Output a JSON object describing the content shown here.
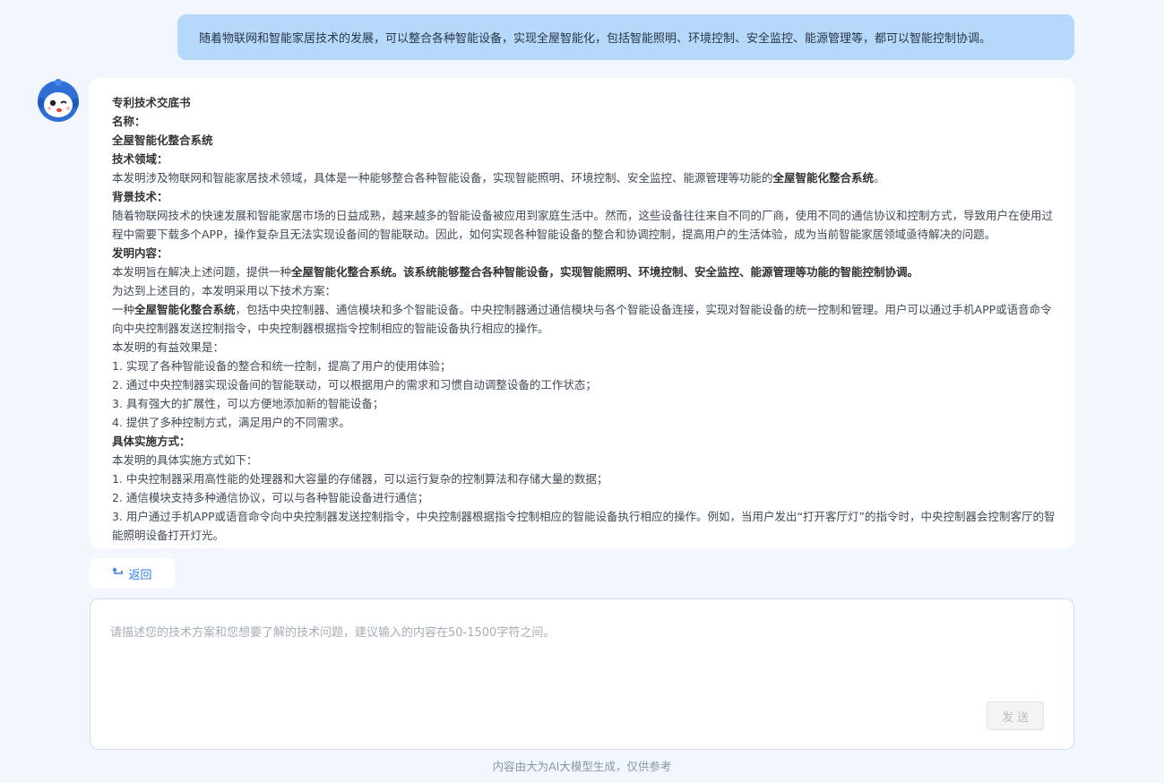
{
  "user_message": "随着物联网和智能家居技术的发展，可以整合各种智能设备，实现全屋智能化，包括智能照明、环境控制、安全监控、能源管理等，都可以智能控制协调。",
  "answer": {
    "l01": "专利技术交底书",
    "l02": "名称：",
    "l03": "全屋智能化整合系统",
    "l04": "技术领域：",
    "l05a": "本发明涉及物联网和智能家居技术领域，具体是一种能够整合各种智能设备，实现智能照明、环境控制、安全监控、能源管理等功能的",
    "l05b": "全屋智能化整合系统",
    "l05c": "。",
    "l06": "背景技术：",
    "l07": "随着物联网技术的快速发展和智能家居市场的日益成熟，越来越多的智能设备被应用到家庭生活中。然而，这些设备往往来自不同的厂商，使用不同的通信协议和控制方式，导致用户在使用过程中需要下载多个APP，操作复杂且无法实现设备间的智能联动。因此，如何实现各种智能设备的整合和协调控制，提高用户的生活体验，成为当前智能家居领域亟待解决的问题。",
    "l08": "发明内容：",
    "l09a": "本发明旨在解决上述问题，提供一种",
    "l09b": "全屋智能化整合系统",
    "l09c": "。该系统能够整合各种智能设备，实现智能照明、环境控制、安全监控、能源管理等功能的智能控制协调。",
    "l10": "为达到上述目的，本发明采用以下技术方案：",
    "l11a": "一种",
    "l11b": "全屋智能化整合系统",
    "l11c": "，包括中央控制器、通信模块和多个智能设备。中央控制器通过通信模块与各个智能设备连接，实现对智能设备的统一控制和管理。用户可以通过手机APP或语音命令向中央控制器发送控制指令，中央控制器根据指令控制相应的智能设备执行相应的操作。",
    "l12": "本发明的有益效果是：",
    "l13": "1. 实现了各种智能设备的整合和统一控制，提高了用户的使用体验；",
    "l14": "2. 通过中央控制器实现设备间的智能联动，可以根据用户的需求和习惯自动调整设备的工作状态；",
    "l15": "3. 具有强大的扩展性，可以方便地添加新的智能设备；",
    "l16": "4. 提供了多种控制方式，满足用户的不同需求。",
    "l17": "具体实施方式：",
    "l18": "本发明的具体实施方式如下：",
    "l19": "1. 中央控制器采用高性能的处理器和大容量的存储器，可以运行复杂的控制算法和存储大量的数据；",
    "l20": "2. 通信模块支持多种通信协议，可以与各种智能设备进行通信；",
    "l21": "3. 用户通过手机APP或语音命令向中央控制器发送控制指令，中央控制器根据指令控制相应的智能设备执行相应的操作。例如，当用户发出“打开客厅灯”的指令时，中央控制器会控制客厅的智能照明设备打开灯光。"
  },
  "back_label": "返回",
  "input": {
    "placeholder": "请描述您的技术方案和您想要了解的技术问题，建议输入的内容在50-1500字符之间。",
    "value": "",
    "send_label": "发送"
  },
  "footer_note": "内容由大为AI大模型生成，仅供参考",
  "colors": {
    "page_bg": "#f2f7fd",
    "user_bubble": "#b6d8fb",
    "accent": "#2d7fe6"
  },
  "icons": {
    "avatar": "robot-mascot-icon",
    "back": "return-arrow-icon"
  }
}
